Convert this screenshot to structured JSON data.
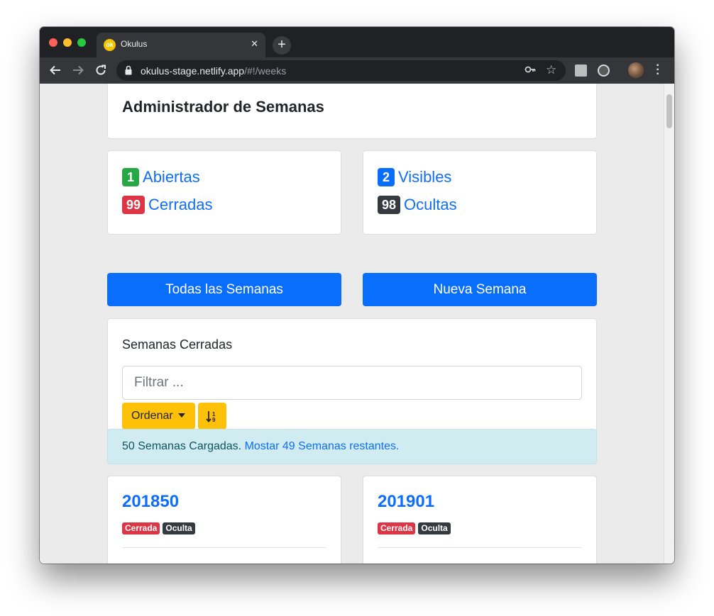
{
  "browser": {
    "tab_title": "Okulus",
    "tab_favicon_text": "ok",
    "url_host": "okulus-stage.netlify.app",
    "url_path": "/#!/weeks"
  },
  "page": {
    "title": "Administrador de Semanas"
  },
  "stats": {
    "left": [
      {
        "count": "1",
        "label": "Abiertas",
        "badge_color": "#28a745"
      },
      {
        "count": "99",
        "label": "Cerradas",
        "badge_color": "#dc3545"
      }
    ],
    "right": [
      {
        "count": "2",
        "label": "Visibles",
        "badge_color": "#0a6efd"
      },
      {
        "count": "98",
        "label": "Ocultas",
        "badge_color": "#343a40"
      }
    ]
  },
  "actions": {
    "all_weeks": "Todas las Semanas",
    "new_week": "Nueva Semana"
  },
  "filter_section": {
    "title": "Semanas Cerradas",
    "placeholder": "Filtrar ...",
    "sort_label": "Ordenar",
    "sort_direction_icon": "sort-numeric-down-icon"
  },
  "alert": {
    "text": "50 Semanas Cargadas.",
    "link": "Mostar 49 Semanas restantes."
  },
  "weeks": [
    {
      "number": "201850",
      "status": "Cerrada",
      "visibility": "Oculta"
    },
    {
      "number": "201901",
      "status": "Cerrada",
      "visibility": "Oculta"
    }
  ],
  "colors": {
    "primary": "#0a6efd",
    "warning": "#ffc107",
    "danger": "#dc3545",
    "dark": "#343a40",
    "success": "#28a745"
  }
}
